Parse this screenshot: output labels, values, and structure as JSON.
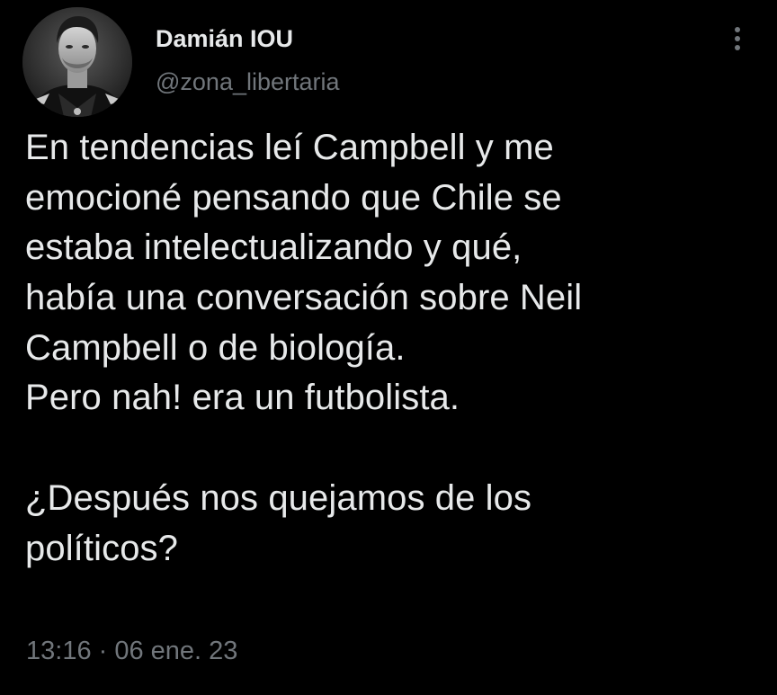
{
  "tweet": {
    "author": {
      "display_name": "Damián IOU",
      "handle": "@zona_libertaria",
      "avatar_icon": "profile-photo"
    },
    "more_icon": "vertical-ellipsis-icon",
    "lines": [
      "En tendencias leí Campbell y me",
      "emocioné pensando que Chile se",
      "estaba intelectualizando y qué,",
      "había una conversación sobre Neil",
      "Campbell o de biología.",
      "Pero nah! era un futbolista.",
      "",
      "¿Después nos quejamos de los",
      "políticos?"
    ],
    "timestamp": "13:16 · 06 ene. 23"
  },
  "colors": {
    "background": "#000000",
    "primary_text": "#e7e9ea",
    "secondary_text": "#71767b"
  }
}
